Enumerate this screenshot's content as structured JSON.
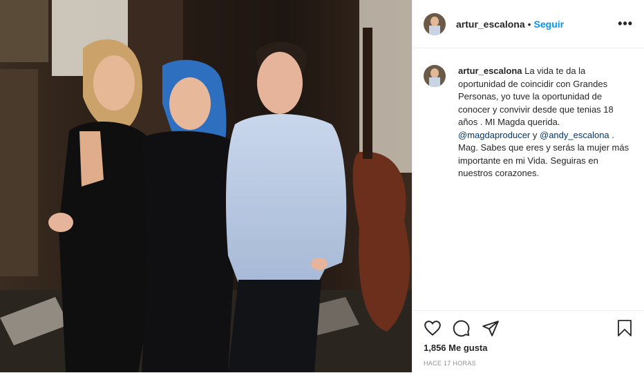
{
  "post": {
    "username": "artur_escalona",
    "separator": "•",
    "follow_label": "Seguir",
    "more_label": "•••"
  },
  "caption": {
    "username": "artur_escalona",
    "text_before": " La vida te da la oportunidad de coincidir con Grandes Personas, yo tuve la oportunidad de conocer y convivir desde que tenias 18 años . MI Magda querida. ",
    "mention1": "@magdaproducer",
    "middle": " y ",
    "mention2": "@andy_escalona",
    "text_after": " . Mag. Sabes que eres y serás la mujer más importante en mi Vida. Seguiras en nuestros corazones."
  },
  "actions": {
    "likes_text": "1,856 Me gusta",
    "time_text": "HACE 17 HORAS"
  },
  "colors": {
    "accent": "#0095f6",
    "mention": "#00376b",
    "muted": "#8e8e8e"
  },
  "icons": [
    "heart-icon",
    "comment-icon",
    "share-icon",
    "bookmark-icon",
    "more-icon"
  ]
}
